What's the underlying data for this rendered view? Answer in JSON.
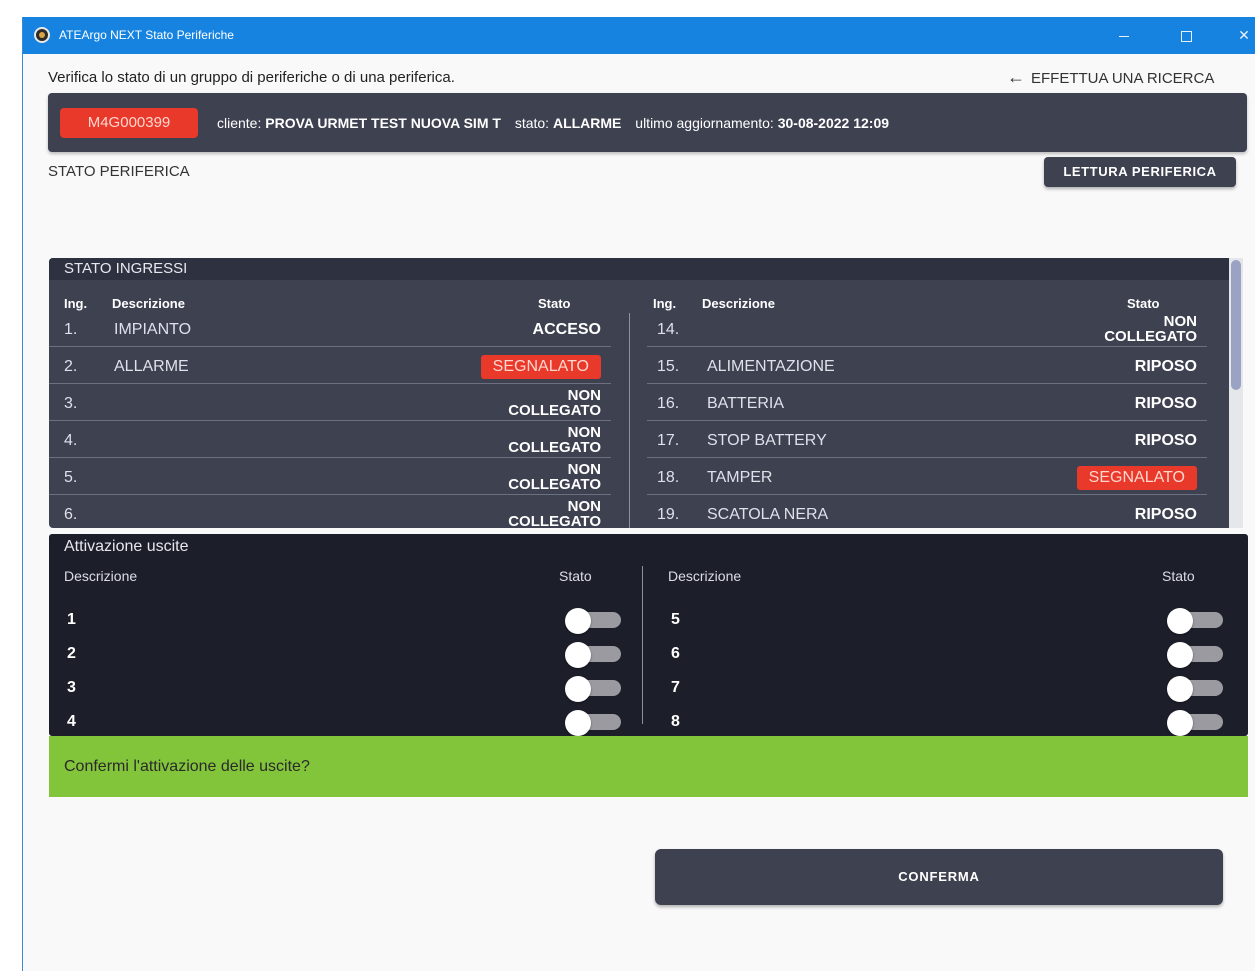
{
  "window": {
    "title": "ATEArgo NEXT Stato Periferiche"
  },
  "header": {
    "subtitle": "Verifica lo stato di un gruppo di periferiche o di una periferica.",
    "back_label": "EFFETTUA UNA RICERCA"
  },
  "device": {
    "code": "M4G000399",
    "cliente_label": "cliente:",
    "cliente": "PROVA URMET TEST NUOVA SIM T",
    "stato_label": "stato:",
    "stato": "ALLARME",
    "update_label": "ultimo aggiornamento:",
    "update": "30-08-2022 12:09"
  },
  "section": {
    "title": "STATO PERIFERICA",
    "read_button": "LETTURA PERIFERICA"
  },
  "inputs": {
    "title": "STATO INGRESSI",
    "col_ing": "Ing.",
    "col_desc": "Descrizione",
    "col_state": "Stato",
    "left": [
      {
        "num": "1.",
        "desc": "IMPIANTO",
        "state": "ACCESO",
        "l1": "",
        "l2": ""
      },
      {
        "num": "2.",
        "desc": "ALLARME",
        "state": "SEGNALATO",
        "l1": "",
        "l2": ""
      },
      {
        "num": "3.",
        "desc": "",
        "state": "",
        "l1": "NON",
        "l2": "COLLEGATO"
      },
      {
        "num": "4.",
        "desc": "",
        "state": "",
        "l1": "NON",
        "l2": "COLLEGATO"
      },
      {
        "num": "5.",
        "desc": "",
        "state": "",
        "l1": "NON",
        "l2": "COLLEGATO"
      },
      {
        "num": "6.",
        "desc": "",
        "state": "",
        "l1": "NON",
        "l2": "COLLEGATO"
      }
    ],
    "right": [
      {
        "num": "14.",
        "desc": "",
        "state": "",
        "l1": "NON",
        "l2": "COLLEGATO"
      },
      {
        "num": "15.",
        "desc": "ALIMENTAZIONE",
        "state": "RIPOSO",
        "l1": "",
        "l2": ""
      },
      {
        "num": "16.",
        "desc": "BATTERIA",
        "state": "RIPOSO",
        "l1": "",
        "l2": ""
      },
      {
        "num": "17.",
        "desc": "STOP BATTERY",
        "state": "RIPOSO",
        "l1": "",
        "l2": ""
      },
      {
        "num": "18.",
        "desc": "TAMPER",
        "state": "SEGNALATO",
        "l1": "",
        "l2": ""
      },
      {
        "num": "19.",
        "desc": "SCATOLA NERA",
        "state": "RIPOSO",
        "l1": "",
        "l2": ""
      }
    ]
  },
  "outputs": {
    "title": "Attivazione uscite",
    "col_desc": "Descrizione",
    "col_state": "Stato",
    "left": [
      {
        "label": "1",
        "on": false
      },
      {
        "label": "2",
        "on": false
      },
      {
        "label": "3",
        "on": false
      },
      {
        "label": "4",
        "on": false
      }
    ],
    "right": [
      {
        "label": "5",
        "on": false
      },
      {
        "label": "6",
        "on": false
      },
      {
        "label": "7",
        "on": false
      },
      {
        "label": "8",
        "on": false
      }
    ]
  },
  "confirm": {
    "question": "Confermi l'attivazione delle uscite?",
    "button": "CONFERMA"
  },
  "colors": {
    "accent": "#1783e0",
    "panel": "#3d4150",
    "alarm": "#e8392a",
    "confirm": "#83c53a"
  }
}
